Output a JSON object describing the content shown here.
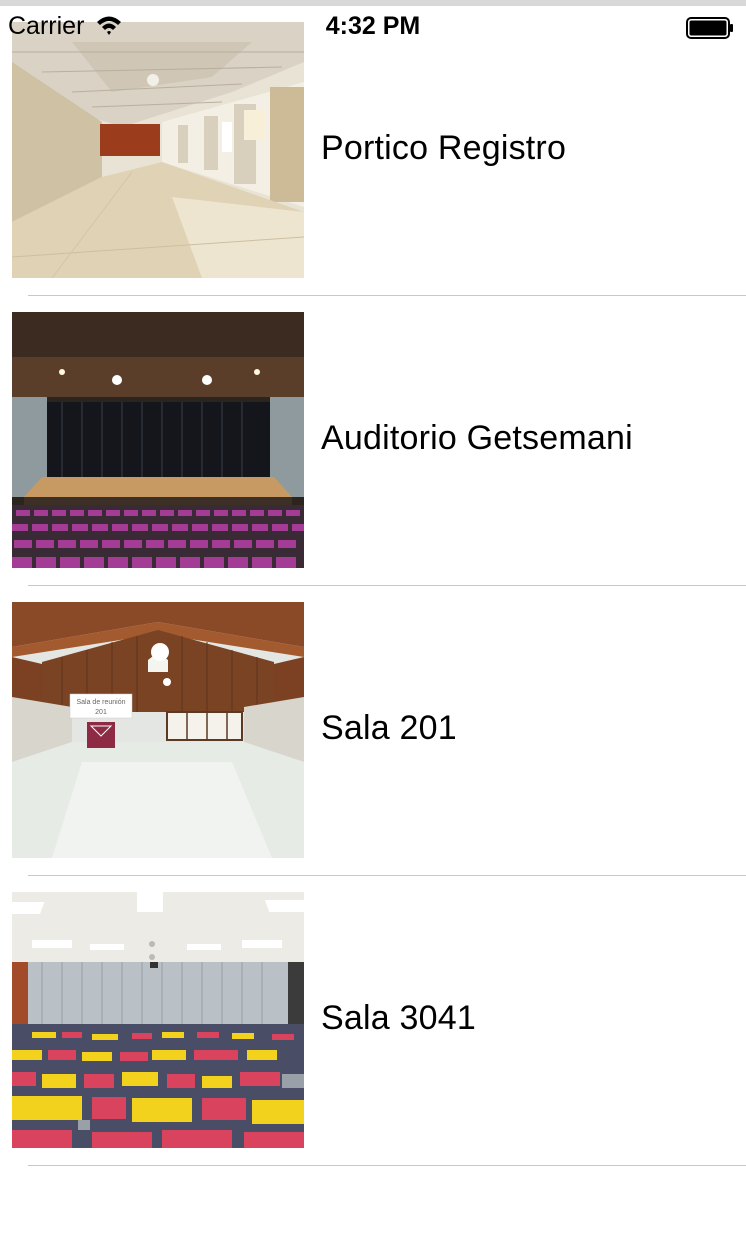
{
  "status_bar": {
    "carrier": "Carrier",
    "time": "4:32 PM"
  },
  "rooms": [
    {
      "name": "Portico Registro",
      "image": "portico-corridor-photo"
    },
    {
      "name": "Auditorio Getsemani",
      "image": "auditorium-stage-photo"
    },
    {
      "name": "Sala 201",
      "image": "wooden-hall-photo",
      "image_text": [
        "Sala de reunión",
        "201"
      ]
    },
    {
      "name": "Sala 3041",
      "image": "carpeted-conference-room-photo"
    }
  ],
  "colors": {
    "separator": "#c8c7cc",
    "background": "#ffffff",
    "text": "#000000"
  }
}
